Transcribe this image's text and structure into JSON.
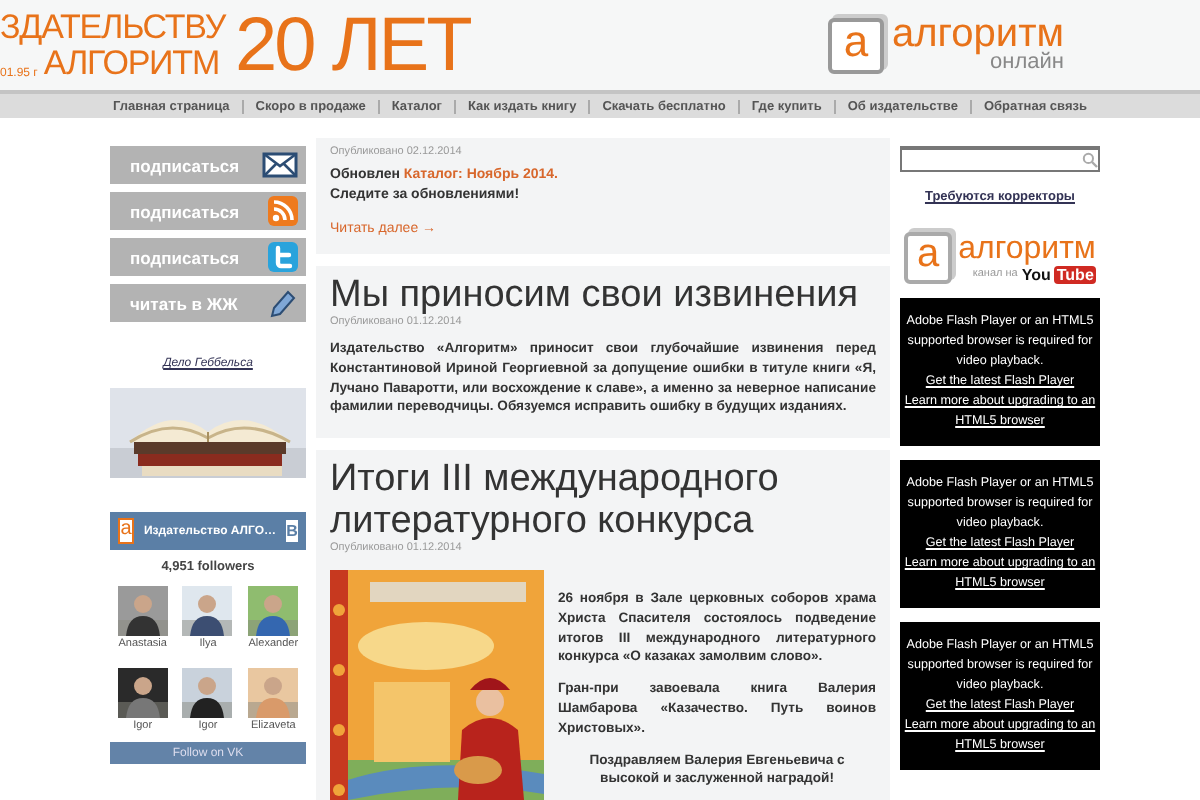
{
  "header": {
    "banner_line1": "ЗДАТЕЛЬСТВУ",
    "banner_line2": "АЛГОРИТМ",
    "banner_small": "01.95 г",
    "banner_big": "20 ЛЕТ",
    "logo_letter": "а",
    "logo_title": "алгоритм",
    "logo_subtitle": "онлайн"
  },
  "nav": [
    "Главная страница",
    "Скоро в продаже",
    "Каталог",
    "Как издать книгу",
    "Скачать бесплатно",
    "Где купить",
    "Об издательстве",
    "Обратная связь"
  ],
  "left": {
    "subscribe": [
      {
        "label": "подписаться",
        "kind": "mail"
      },
      {
        "label": "подписаться",
        "kind": "rss"
      },
      {
        "label": "подписаться",
        "kind": "twitter"
      },
      {
        "label": "читать в ЖЖ",
        "kind": "pencil"
      }
    ],
    "link": "Дело Геббельса",
    "vk": {
      "logo_letter": "а",
      "title": "Издательство АЛГО…",
      "badge": "В",
      "followers": "4,951 followers",
      "members": [
        {
          "name": "Anastasia"
        },
        {
          "name": "Ilya"
        },
        {
          "name": "Alexander"
        },
        {
          "name": "Igor"
        },
        {
          "name": "Igor"
        },
        {
          "name": "Elizaveta"
        }
      ],
      "button": "Follow on VK"
    }
  },
  "posts": [
    {
      "date": "Опубликовано 02.12.2014",
      "lead": "Обновлен",
      "link": "Каталог: Ноябрь 2014.",
      "line2": "Следите за обновлениями!",
      "more": "Читать далее →"
    },
    {
      "title": "Мы приносим свои извинения",
      "date": "Опубликовано 01.12.2014",
      "body": "Издательство «Алгоритм» приносит свои глубочайшие извинения перед Константиновой Ириной Георгиевной за допущение ошибки в титуле книги «Я, Лучано Паваротти, или восхождение к славе», а именно за неверное написание фамилии переводчицы. Обязуемся исправить ошибку в будущих изданиях."
    },
    {
      "title": "Итоги III международного литературного конкурса",
      "date": "Опубликовано 01.12.2014",
      "paragraphs": [
        "26 ноября в Зале церковных соборов храма Христа Спасителя состоялось подведение итогов III международного литературного конкурса «О казаках замолвим слово».",
        "Гран-при завоевала книга Валерия Шамбарова «Казачество. Путь воинов Христовых».",
        "Поздравляем Валерия Евгеньевича с высокой и заслуженной наградой!"
      ]
    }
  ],
  "right": {
    "link": "Требуются корректоры",
    "channel": {
      "logo_letter": "а",
      "title": "алгоритм",
      "caption": "канал на",
      "yt_left": "You",
      "yt_right": "Tube"
    },
    "videos": [
      {
        "message": "Adobe Flash Player or an HTML5 supported browser is required for video playback.",
        "link1": "Get the latest Flash Player",
        "link2": "Learn more about upgrading to an HTML5 browser"
      },
      {
        "message": "Adobe Flash Player or an HTML5 supported browser is required for video playback.",
        "link1": "Get the latest Flash Player",
        "link2": "Learn more about upgrading to an HTML5 browser"
      },
      {
        "message": "Adobe Flash Player or an HTML5 supported browser is required for video playback.",
        "link1": "Get the latest Flash Player",
        "link2": "Learn more about upgrading to an HTML5 browser"
      }
    ]
  }
}
